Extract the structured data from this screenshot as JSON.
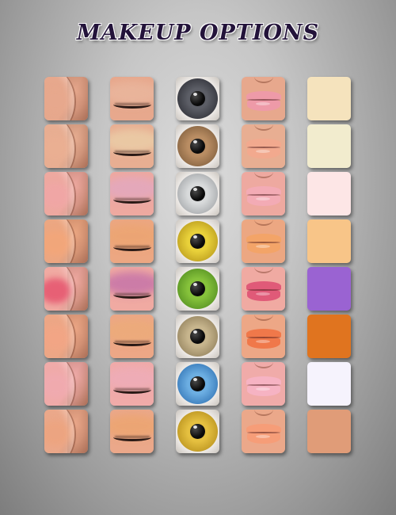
{
  "title": "MAKEUP OPTIONS",
  "columns": [
    "cheek",
    "eyelid",
    "iris",
    "lips",
    "swatch"
  ],
  "rows": [
    {
      "skin": "#e7a88d",
      "blush": "#e7a88d",
      "eyelid": "#e9b59c",
      "iris": [
        "#5c5e66",
        "#2b2c33"
      ],
      "lips": "#ee9aa8",
      "swatch": "#f5e3bd"
    },
    {
      "skin": "#e8ae92",
      "blush": "#eaaf92",
      "eyelid": "#eacba6",
      "iris": [
        "#b98d63",
        "#7d5c3b"
      ],
      "lips": "#f2a98e",
      "swatch": "#f2ecce"
    },
    {
      "skin": "#eea9a0",
      "blush": "#f0a6a6",
      "eyelid": "#e3a8bd",
      "iris": [
        "#d8dadb",
        "#9ea1a4"
      ],
      "lips": "#f3abb5",
      "swatch": "#fde6e6"
    },
    {
      "skin": "#eca782",
      "blush": "#f3a679",
      "eyelid": "#eca573",
      "iris": [
        "#e9d13a",
        "#b4951a"
      ],
      "lips": "#f3a468",
      "swatch": "#f8c588"
    },
    {
      "skin": "#f0aaa2",
      "blush": "#e5546e",
      "eyelid": "#c877a8",
      "iris": [
        "#86c23b",
        "#4f8a1f"
      ],
      "lips": "#e05a78",
      "swatch": "#9a63d2"
    },
    {
      "skin": "#eda786",
      "blush": "#f2a585",
      "eyelid": "#ecab7a",
      "iris": [
        "#c7b58d",
        "#8d7c58"
      ],
      "lips": "#f0784a",
      "swatch": "#e0741f"
    },
    {
      "skin": "#f0aba9",
      "blush": "#f0aab0",
      "eyelid": "#eeacb7",
      "iris": [
        "#6caee2",
        "#2d6fb1"
      ],
      "lips": "#f6b3c3",
      "swatch": "#f6f3fd"
    },
    {
      "skin": "#eba88a",
      "blush": "#eda47f",
      "eyelid": "#eca572",
      "iris": [
        "#e5c040",
        "#b38c1a"
      ],
      "lips": "#f69d78",
      "swatch": "#e09c78"
    }
  ]
}
